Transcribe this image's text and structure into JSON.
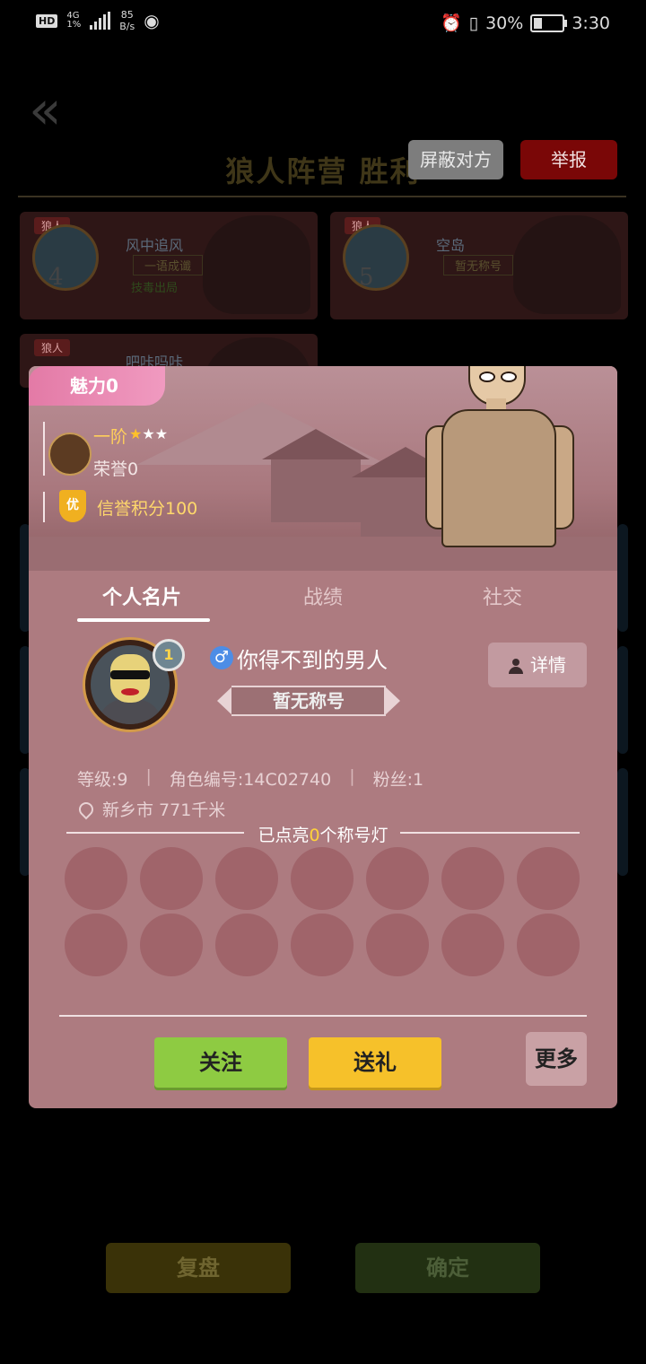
{
  "status_bar": {
    "hd": "HD",
    "network": "4G",
    "network_sub": "1%",
    "speed_value": "85",
    "speed_unit": "B/s",
    "battery": "30%",
    "time": "3:30"
  },
  "background": {
    "result_title": "狼人阵营  胜利",
    "block_button": "屏蔽对方",
    "report_button": "举报",
    "players": [
      {
        "role": "狼人",
        "number": "4",
        "name": "风中追风",
        "title": "一语成谶",
        "extra": "技毒出局"
      },
      {
        "role": "狼人",
        "number": "5",
        "name": "空岛",
        "title": "暂无称号"
      },
      {
        "role": "狼人",
        "name": "吧咔吗咔"
      }
    ],
    "replay_button": "复盘",
    "confirm_button": "确定"
  },
  "profile": {
    "charm": "魅力0",
    "rank": "一阶",
    "honor": "荣誉0",
    "credit_badge": "优",
    "credit": "信誉积分100",
    "tabs": [
      "个人名片",
      "战绩",
      "社交"
    ],
    "level_badge": "1",
    "gender_symbol": "♂",
    "nickname": "你得不到的男人",
    "title": "暂无称号",
    "details_button": "详情",
    "stats": {
      "level": "等级:9",
      "role_id": "角色编号:14C02740",
      "fans": "粉丝:1"
    },
    "location": "新乡市  771千米",
    "lamps_prefix": "已点亮",
    "lamps_count": "0",
    "lamps_suffix": "个称号灯",
    "follow_button": "关注",
    "gift_button": "送礼",
    "more_button": "更多"
  },
  "colors": {
    "dialog_bg": "#ad7b80",
    "charm_pink": "#e37aa6",
    "follow_green": "#8ecb42",
    "gift_yellow": "#f6c12a",
    "report_red": "#7a0707"
  }
}
